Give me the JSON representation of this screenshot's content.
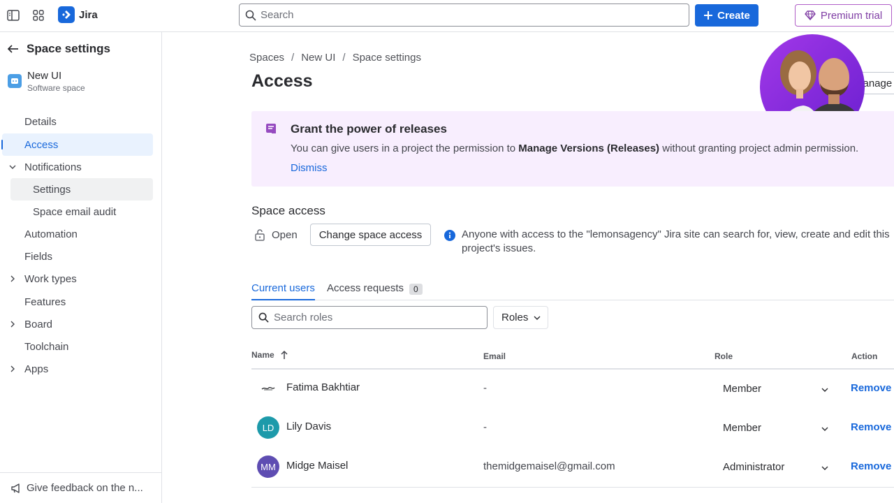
{
  "topbar": {
    "app_name": "Jira",
    "search_placeholder": "Search",
    "create_label": "Create",
    "premium_label": "Premium trial"
  },
  "sidebar": {
    "title": "Space settings",
    "space_name": "New UI",
    "space_type": "Software space",
    "items": [
      {
        "label": "Details"
      },
      {
        "label": "Access"
      },
      {
        "label": "Notifications"
      },
      {
        "label": "Settings"
      },
      {
        "label": "Space email audit"
      },
      {
        "label": "Automation"
      },
      {
        "label": "Fields"
      },
      {
        "label": "Work types"
      },
      {
        "label": "Features"
      },
      {
        "label": "Board"
      },
      {
        "label": "Toolchain"
      },
      {
        "label": "Apps"
      }
    ],
    "feedback_label": "Give feedback on the n..."
  },
  "breadcrumb": [
    "Spaces",
    "New UI",
    "Space settings"
  ],
  "page_title": "Access",
  "manage_roles_label": "Manage roles",
  "banner": {
    "heading": "Grant the power of releases",
    "text_before": "You can give users in a project the permission to ",
    "text_bold": "Manage Versions (Releases)",
    "text_after": " without granting project admin permission.",
    "dismiss": "Dismiss"
  },
  "space_access": {
    "heading": "Space access",
    "status": "Open",
    "change_label": "Change space access",
    "info": "Anyone with access to the \"lemonsagency\" Jira site can search for, view, create and edit this project's issues."
  },
  "tabs": {
    "current_users": "Current users",
    "access_requests": "Access requests",
    "access_requests_count": "0"
  },
  "filter": {
    "search_placeholder": "Search roles",
    "roles_label": "Roles"
  },
  "table": {
    "headers": {
      "name": "Name",
      "email": "Email",
      "role": "Role",
      "action": "Action"
    },
    "rows": [
      {
        "name": "Fatima Bakhtiar",
        "email": "-",
        "role": "Member",
        "action": "Remove",
        "initials": "",
        "avatar_color": "#ffffff"
      },
      {
        "name": "Lily Davis",
        "email": "-",
        "role": "Member",
        "action": "Remove",
        "initials": "LD",
        "avatar_color": "#1d9aaa"
      },
      {
        "name": "Midge Maisel",
        "email": "themidgemaisel@gmail.com",
        "role": "Administrator",
        "action": "Remove",
        "initials": "MM",
        "avatar_color": "#5e4db2"
      }
    ]
  },
  "colors": {
    "brand": "#1868db",
    "premium": "#803fa5",
    "banner_bg": "#f8eefe"
  }
}
